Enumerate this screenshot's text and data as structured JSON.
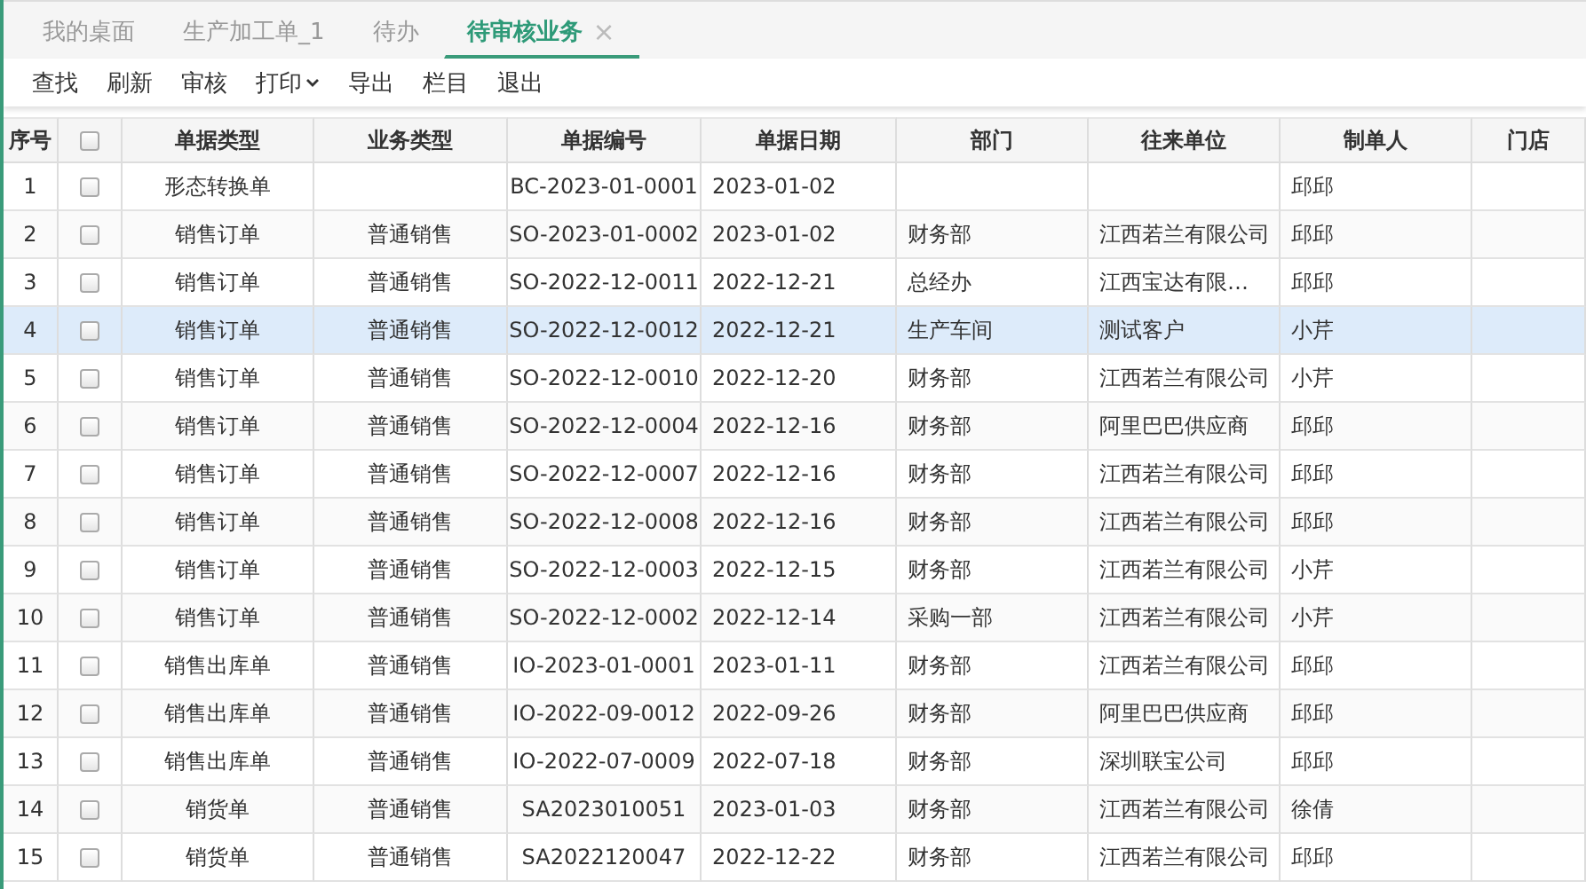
{
  "tabs": [
    {
      "label": "我的桌面",
      "selected": false
    },
    {
      "label": "生产加工单_1",
      "selected": false
    },
    {
      "label": "待办",
      "selected": false
    },
    {
      "label": "待审核业务",
      "selected": true,
      "close": "×"
    }
  ],
  "toolbar": [
    {
      "label": "查找"
    },
    {
      "label": "刷新"
    },
    {
      "label": "审核"
    },
    {
      "label": "打印",
      "dropdown": true
    },
    {
      "label": "导出"
    },
    {
      "label": "栏目"
    },
    {
      "label": "退出"
    }
  ],
  "table": {
    "columns": [
      "序号",
      "单据类型",
      "业务类型",
      "单据编号",
      "单据日期",
      "部门",
      "往来单位",
      "制单人",
      "门店"
    ],
    "header_checked": false,
    "rows": [
      {
        "no": "1",
        "checked": false,
        "selected": false,
        "doc_type": "形态转换单",
        "doc_no": "BC-2023-01-0001",
        "date": "2023-01-02",
        "maker": "邱邱"
      },
      {
        "no": "2",
        "checked": false,
        "selected": false,
        "doc_type": "销售订单",
        "biz_type": "普通销售",
        "doc_no": "SO-2023-01-0002",
        "date": "2023-01-02",
        "dept": "财务部",
        "partner": "江西若兰有限公司",
        "maker": "邱邱"
      },
      {
        "no": "3",
        "checked": false,
        "selected": false,
        "doc_type": "销售订单",
        "biz_type": "普通销售",
        "doc_no": "SO-2022-12-0011",
        "date": "2022-12-21",
        "dept": "总经办",
        "partner": "江西宝达有限…",
        "maker": "邱邱"
      },
      {
        "no": "4",
        "checked": false,
        "selected": true,
        "doc_type": "销售订单",
        "biz_type": "普通销售",
        "doc_no": "SO-2022-12-0012",
        "date": "2022-12-21",
        "dept": "生产车间",
        "partner": "测试客户",
        "maker": "小芹"
      },
      {
        "no": "5",
        "checked": false,
        "selected": false,
        "doc_type": "销售订单",
        "biz_type": "普通销售",
        "doc_no": "SO-2022-12-0010",
        "date": "2022-12-20",
        "dept": "财务部",
        "partner": "江西若兰有限公司",
        "maker": "小芹"
      },
      {
        "no": "6",
        "checked": false,
        "selected": false,
        "doc_type": "销售订单",
        "biz_type": "普通销售",
        "doc_no": "SO-2022-12-0004",
        "date": "2022-12-16",
        "dept": "财务部",
        "partner": "阿里巴巴供应商",
        "maker": "邱邱"
      },
      {
        "no": "7",
        "checked": false,
        "selected": false,
        "doc_type": "销售订单",
        "biz_type": "普通销售",
        "doc_no": "SO-2022-12-0007",
        "date": "2022-12-16",
        "dept": "财务部",
        "partner": "江西若兰有限公司",
        "maker": "邱邱"
      },
      {
        "no": "8",
        "checked": false,
        "selected": false,
        "doc_type": "销售订单",
        "biz_type": "普通销售",
        "doc_no": "SO-2022-12-0008",
        "date": "2022-12-16",
        "dept": "财务部",
        "partner": "江西若兰有限公司",
        "maker": "邱邱"
      },
      {
        "no": "9",
        "checked": false,
        "selected": false,
        "doc_type": "销售订单",
        "biz_type": "普通销售",
        "doc_no": "SO-2022-12-0003",
        "date": "2022-12-15",
        "dept": "财务部",
        "partner": "江西若兰有限公司",
        "maker": "小芹"
      },
      {
        "no": "10",
        "checked": false,
        "selected": false,
        "doc_type": "销售订单",
        "biz_type": "普通销售",
        "doc_no": "SO-2022-12-0002",
        "date": "2022-12-14",
        "dept": "采购一部",
        "partner": "江西若兰有限公司",
        "maker": "小芹"
      },
      {
        "no": "11",
        "checked": false,
        "selected": false,
        "doc_type": "销售出库单",
        "biz_type": "普通销售",
        "doc_no": "IO-2023-01-0001",
        "date": "2023-01-11",
        "dept": "财务部",
        "partner": "江西若兰有限公司",
        "maker": "邱邱"
      },
      {
        "no": "12",
        "checked": false,
        "selected": false,
        "doc_type": "销售出库单",
        "biz_type": "普通销售",
        "doc_no": "IO-2022-09-0012",
        "date": "2022-09-26",
        "dept": "财务部",
        "partner": "阿里巴巴供应商",
        "maker": "邱邱"
      },
      {
        "no": "13",
        "checked": false,
        "selected": false,
        "doc_type": "销售出库单",
        "biz_type": "普通销售",
        "doc_no": "IO-2022-07-0009",
        "date": "2022-07-18",
        "dept": "财务部",
        "partner": "深圳联宝公司",
        "maker": "邱邱"
      },
      {
        "no": "14",
        "checked": false,
        "selected": false,
        "doc_type": "销货单",
        "biz_type": "普通销售",
        "doc_no": "SA2023010051",
        "date": "2023-01-03",
        "dept": "财务部",
        "partner": "江西若兰有限公司",
        "maker": "徐倩"
      },
      {
        "no": "15",
        "checked": false,
        "selected": false,
        "doc_type": "销货单",
        "biz_type": "普通销售",
        "doc_no": "SA2022120047",
        "date": "2022-12-22",
        "dept": "财务部",
        "partner": "江西若兰有限公司",
        "maker": "邱邱"
      }
    ]
  }
}
